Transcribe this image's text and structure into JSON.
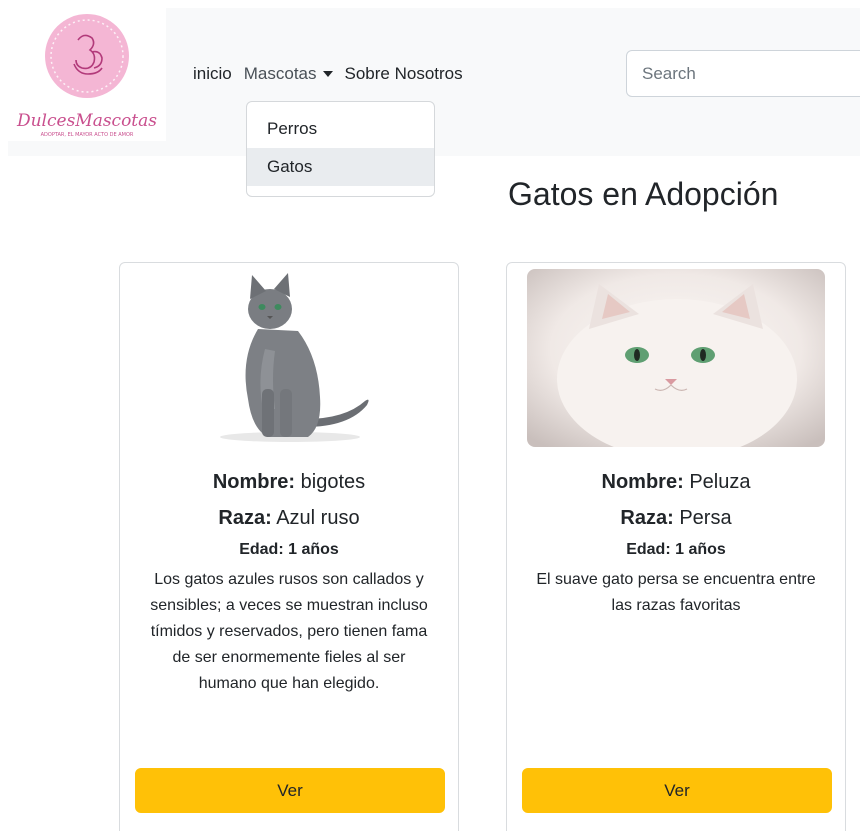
{
  "brand": {
    "logo_text": "DulcesMascotas",
    "tagline": "ADOPTAR, EL MAYOR ACTO DE AMOR"
  },
  "nav": {
    "items": [
      {
        "label": "inicio"
      },
      {
        "label": "Mascotas"
      },
      {
        "label": "Sobre Nosotros"
      }
    ]
  },
  "search": {
    "placeholder": "Search",
    "value": ""
  },
  "dropdown": {
    "items": [
      {
        "label": "Perros",
        "active": false
      },
      {
        "label": "Gatos",
        "active": true
      }
    ]
  },
  "page": {
    "title": "Gatos en Adopción"
  },
  "cards": [
    {
      "name_label": "Nombre:",
      "name": "bigotes",
      "breed_label": "Raza:",
      "breed": "Azul ruso",
      "age_label": "Edad:",
      "age": "1 años",
      "description": "Los gatos azules rusos son callados y sensibles; a veces se muestran incluso tímidos y reservados, pero tienen fama de ser enormemente fieles al ser humano que han elegido.",
      "button": "Ver"
    },
    {
      "name_label": "Nombre:",
      "name": "Peluza",
      "breed_label": "Raza:",
      "breed": "Persa",
      "age_label": "Edad:",
      "age": "1 años",
      "description": "El suave gato persa se encuentra entre las razas favoritas",
      "button": "Ver"
    }
  ],
  "colors": {
    "navbar_bg": "#f8f9fa",
    "button_warning": "#ffc107",
    "logo_pink": "#f4b6d4",
    "logo_text": "#c94f8e"
  }
}
